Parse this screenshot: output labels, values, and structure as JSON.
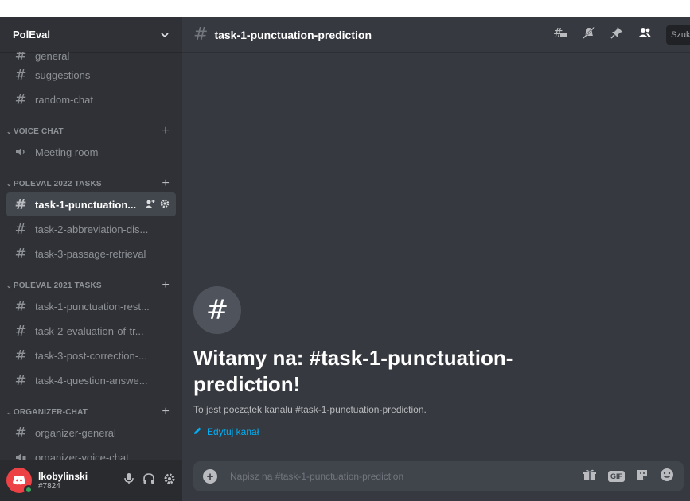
{
  "server": {
    "name": "PolEval"
  },
  "channels_top": [
    {
      "name": "general",
      "partial": true
    },
    {
      "name": "suggestions"
    },
    {
      "name": "random-chat"
    }
  ],
  "categories": [
    {
      "name": "VOICE CHAT",
      "channels": [
        {
          "name": "Meeting room",
          "type": "voice"
        }
      ]
    },
    {
      "name": "POLEVAL 2022 TASKS",
      "channels": [
        {
          "name": "task-1-punctuation...",
          "type": "text",
          "active": true
        },
        {
          "name": "task-2-abbreviation-dis...",
          "type": "text"
        },
        {
          "name": "task-3-passage-retrieval",
          "type": "text"
        }
      ]
    },
    {
      "name": "POLEVAL 2021 TASKS",
      "channels": [
        {
          "name": "task-1-punctuation-rest...",
          "type": "text"
        },
        {
          "name": "task-2-evaluation-of-tr...",
          "type": "text"
        },
        {
          "name": "task-3-post-correction-...",
          "type": "text"
        },
        {
          "name": "task-4-question-answe...",
          "type": "text"
        }
      ]
    },
    {
      "name": "ORGANIZER-CHAT",
      "channels": [
        {
          "name": "organizer-general",
          "type": "locked-text"
        },
        {
          "name": "organizer-voice-chat",
          "type": "locked-voice"
        }
      ]
    }
  ],
  "user": {
    "name": "lkobylinski",
    "tag": "#7824"
  },
  "channel": {
    "title": "task-1-punctuation-prediction"
  },
  "search": {
    "placeholder": "Szuk"
  },
  "welcome": {
    "title": "Witamy na: #task-1-punctuation-prediction!",
    "subtitle": "To jest początek kanału #task-1-punctuation-prediction.",
    "edit": "Edytuj kanał"
  },
  "composer": {
    "placeholder": "Napisz na #task-1-punctuation-prediction",
    "gif_label": "GIF"
  },
  "colors": {
    "sidebar": "#2f3136",
    "main": "#36393f",
    "accent_link": "#00aff4",
    "active_channel": "#42464d"
  }
}
